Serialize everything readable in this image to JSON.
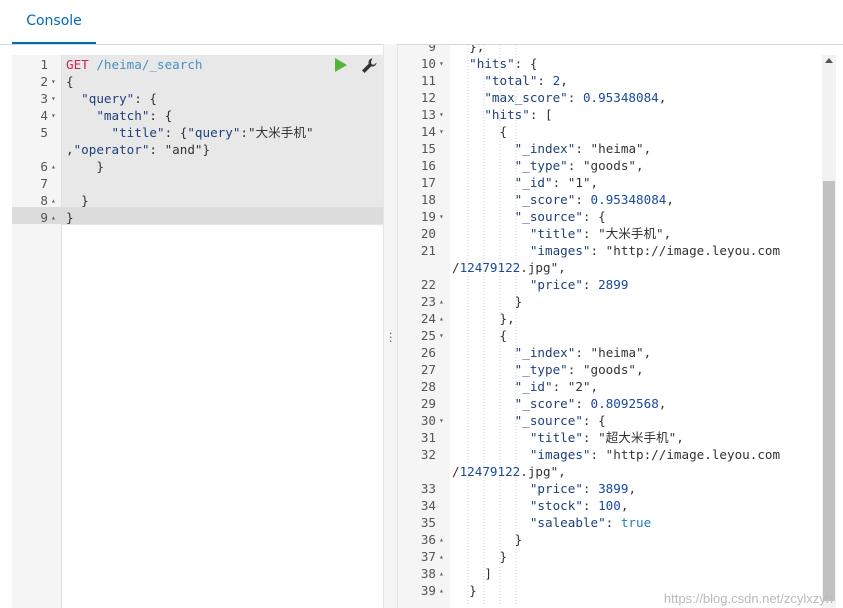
{
  "tabs": {
    "console": "Console"
  },
  "request": {
    "lines": [
      {
        "n": "1",
        "fold": "",
        "html": [
          [
            "method",
            "GET"
          ],
          [
            "",
            " "
          ],
          [
            "url",
            "/heima/_search"
          ]
        ]
      },
      {
        "n": "2",
        "fold": "▾",
        "html": [
          [
            "",
            "{"
          ]
        ]
      },
      {
        "n": "3",
        "fold": "▾",
        "html": [
          [
            "",
            "  "
          ],
          [
            "key",
            "\"query\""
          ],
          [
            "",
            ": {"
          ]
        ]
      },
      {
        "n": "4",
        "fold": "▾",
        "html": [
          [
            "",
            "    "
          ],
          [
            "key",
            "\"match\""
          ],
          [
            "",
            ": {"
          ]
        ]
      },
      {
        "n": "5",
        "fold": "",
        "html": [
          [
            "",
            "      "
          ],
          [
            "key",
            "\"title\""
          ],
          [
            "",
            ": {"
          ],
          [
            "key",
            "\"query\""
          ],
          [
            "",
            ":"
          ],
          [
            "str",
            "\"大米手机\""
          ]
        ]
      },
      {
        "n": "",
        "fold": "",
        "html": [
          [
            "",
            ","
          ],
          [
            "key",
            "\"operator\""
          ],
          [
            "",
            ": "
          ],
          [
            "str",
            "\"and\""
          ],
          [
            "",
            "}"
          ]
        ]
      },
      {
        "n": "6",
        "fold": "▴",
        "html": [
          [
            "",
            "    }"
          ]
        ]
      },
      {
        "n": "7",
        "fold": "",
        "html": [
          [
            "",
            ""
          ]
        ]
      },
      {
        "n": "8",
        "fold": "▴",
        "html": [
          [
            "",
            "  }"
          ]
        ]
      },
      {
        "n": "9",
        "fold": "▴",
        "html": [
          [
            "",
            "}"
          ]
        ]
      }
    ]
  },
  "response": {
    "lines": [
      {
        "n": "9",
        "fold": "",
        "t": "  },"
      },
      {
        "n": "10",
        "fold": "▾",
        "t": "  \"hits\": {"
      },
      {
        "n": "11",
        "fold": "",
        "t": "    \"total\": 2,"
      },
      {
        "n": "12",
        "fold": "",
        "t": "    \"max_score\": 0.95348084,"
      },
      {
        "n": "13",
        "fold": "▾",
        "t": "    \"hits\": ["
      },
      {
        "n": "14",
        "fold": "▾",
        "t": "      {"
      },
      {
        "n": "15",
        "fold": "",
        "t": "        \"_index\": \"heima\","
      },
      {
        "n": "16",
        "fold": "",
        "t": "        \"_type\": \"goods\","
      },
      {
        "n": "17",
        "fold": "",
        "t": "        \"_id\": \"1\","
      },
      {
        "n": "18",
        "fold": "",
        "t": "        \"_score\": 0.95348084,"
      },
      {
        "n": "19",
        "fold": "▾",
        "t": "        \"_source\": {"
      },
      {
        "n": "20",
        "fold": "",
        "t": "          \"title\": \"大米手机\","
      },
      {
        "n": "21",
        "fold": "",
        "t": "          \"images\": \"http://image.leyou.com"
      },
      {
        "n": "",
        "fold": "",
        "t": "/12479122.jpg\","
      },
      {
        "n": "22",
        "fold": "",
        "t": "          \"price\": 2899"
      },
      {
        "n": "23",
        "fold": "▴",
        "t": "        }"
      },
      {
        "n": "24",
        "fold": "▴",
        "t": "      },"
      },
      {
        "n": "25",
        "fold": "▾",
        "t": "      {"
      },
      {
        "n": "26",
        "fold": "",
        "t": "        \"_index\": \"heima\","
      },
      {
        "n": "27",
        "fold": "",
        "t": "        \"_type\": \"goods\","
      },
      {
        "n": "28",
        "fold": "",
        "t": "        \"_id\": \"2\","
      },
      {
        "n": "29",
        "fold": "",
        "t": "        \"_score\": 0.8092568,"
      },
      {
        "n": "30",
        "fold": "▾",
        "t": "        \"_source\": {"
      },
      {
        "n": "31",
        "fold": "",
        "t": "          \"title\": \"超大米手机\","
      },
      {
        "n": "32",
        "fold": "",
        "t": "          \"images\": \"http://image.leyou.com"
      },
      {
        "n": "",
        "fold": "",
        "t": "/12479122.jpg\","
      },
      {
        "n": "33",
        "fold": "",
        "t": "          \"price\": 3899,"
      },
      {
        "n": "34",
        "fold": "",
        "t": "          \"stock\": 100,"
      },
      {
        "n": "35",
        "fold": "",
        "t": "          \"saleable\": true"
      },
      {
        "n": "36",
        "fold": "▴",
        "t": "        }"
      },
      {
        "n": "37",
        "fold": "▴",
        "t": "      }"
      },
      {
        "n": "38",
        "fold": "▴",
        "t": "    ]"
      },
      {
        "n": "39",
        "fold": "▴",
        "t": "  }"
      }
    ]
  },
  "icons": {
    "run": "play-icon",
    "settings": "wrench-icon",
    "resize": "drag-dots-icon",
    "scroll_up": "chevron-up-icon"
  },
  "watermark": "https://blog.csdn.net/zcylxzyh",
  "colors": {
    "accent": "#006bb4",
    "run": "#54b435"
  }
}
